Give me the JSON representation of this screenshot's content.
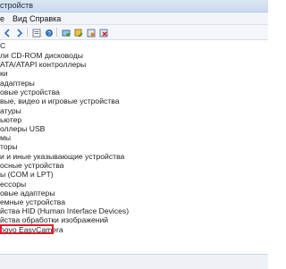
{
  "window": {
    "title": "стройств"
  },
  "menu": {
    "items": [
      "е",
      "Вид",
      "Справка"
    ]
  },
  "toolbar": {
    "icons": [
      "back-arrow-icon",
      "forward-arrow-icon",
      "properties-icon",
      "help-icon",
      "scan-hardware-icon",
      "update-driver-icon",
      "disable-device-icon",
      "uninstall-device-icon"
    ]
  },
  "tree": {
    "items": [
      "C",
      "ли CD-ROM дисководы",
      "ATA/ATAPI контроллеры",
      "ки",
      "адаптеры",
      "овые устройства",
      "вые, видео и игровые устройства",
      "атуры",
      "ьютер",
      "оллеры USB",
      "мы",
      "торы",
      "и и иные указывающие устройства",
      "осные устройства",
      "ы (COM и LPT)",
      "ессоры",
      "овые адаптеры",
      "емные устройства",
      "йства HID (Human Interface Devices)",
      "йства обработки изображений",
      "novo EasyCamera"
    ],
    "selected_label": "novo EasyCamera"
  },
  "colors": {
    "highlight": "#e01c2a"
  }
}
